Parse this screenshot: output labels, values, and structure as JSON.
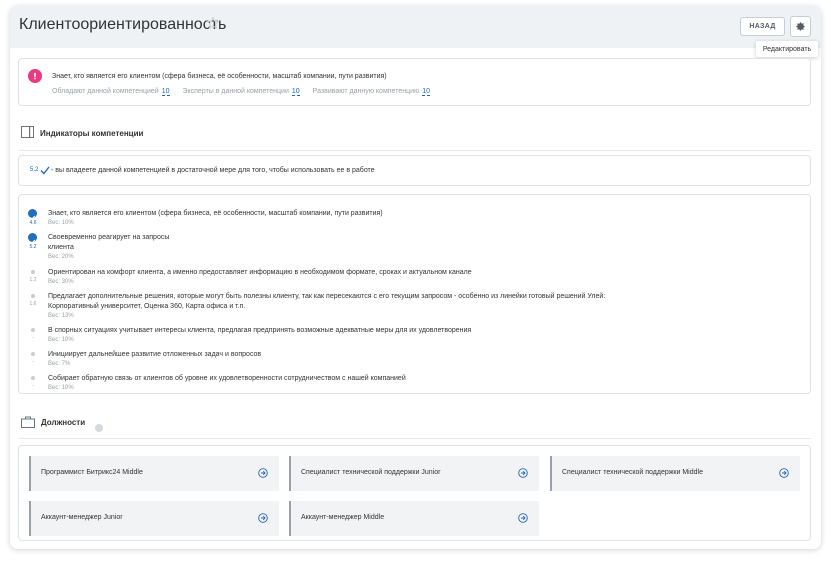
{
  "header": {
    "title": "Клиентоориентированность",
    "back_label": "НАЗАД",
    "tooltip": "Редактировать"
  },
  "competence": {
    "title": "Знает, кто является его клиентом (сфера бизнеса, её особенности, масштаб компании, пути развития)",
    "stats": [
      {
        "label": "Обладают данной компетенцией",
        "value": "10"
      },
      {
        "label": "Эксперты в данной компетенции",
        "value": "10"
      },
      {
        "label": "Развивают данную компетенцию",
        "value": "10"
      }
    ]
  },
  "indicators_section": {
    "title": "Индикаторы компетенции"
  },
  "level": {
    "value": "5.2",
    "text": "- вы владеете данной компетенцией в достаточной мере для того, чтобы использовать ее в работе"
  },
  "indicators": [
    {
      "text": "Знает, кто является его клиентом (сфера бизнеса, её особенности, масштаб компании, пути развития)",
      "weight": "Вес: 10%",
      "score": "4.6",
      "done": true
    },
    {
      "text": "Своевременно реагирует на запросы клиента",
      "weight": "Вес: 20%",
      "score": "5.2",
      "done": true
    },
    {
      "text": "Ориентирован на комфорт клиента, а именно предоставляет информацию в необходимом формате, сроках и актуальном канале",
      "weight": "Вес: 30%",
      "score": "1.2",
      "done": false
    },
    {
      "text": "Предлагает дополнительные решения, которые могут быть полезны клиенту, так как пересекаются с его текущим запросом - особенно из линейки готовый решений Улей: Корпоративный университет, Оценка 360, Карта офиса и т.п.",
      "weight": "Вес: 13%",
      "score": "1.6",
      "done": false
    },
    {
      "text": "В спорных ситуациях учитывает интересы клиента, предлагая предпринять возможные адекватные меры для их удовлетворения",
      "weight": "Вес: 10%",
      "score": "-",
      "done": false
    },
    {
      "text": "Инициирует дальнейшее развитие отложенных задач и вопросов",
      "weight": "Вес: 7%",
      "score": "-",
      "done": false
    },
    {
      "text": "Собирает обратную связь от клиентов об уровне их удовлетворенности сотрудничеством с нашей компанией",
      "weight": "Вес: 10%",
      "score": "-",
      "done": false
    }
  ],
  "positions_section": {
    "title": "Должности"
  },
  "positions": [
    {
      "label": "Программист Битрикс24 Middle"
    },
    {
      "label": "Специалист технической поддержки Junior"
    },
    {
      "label": "Специалист технической поддержки Middle"
    },
    {
      "label": "Аккаунт-менеджер Junior"
    },
    {
      "label": "Аккаунт-менеджер Middle"
    }
  ],
  "colors": {
    "accent": "#2067b0",
    "competence_icon": "#e93a83",
    "check": "#1e6fbd"
  }
}
